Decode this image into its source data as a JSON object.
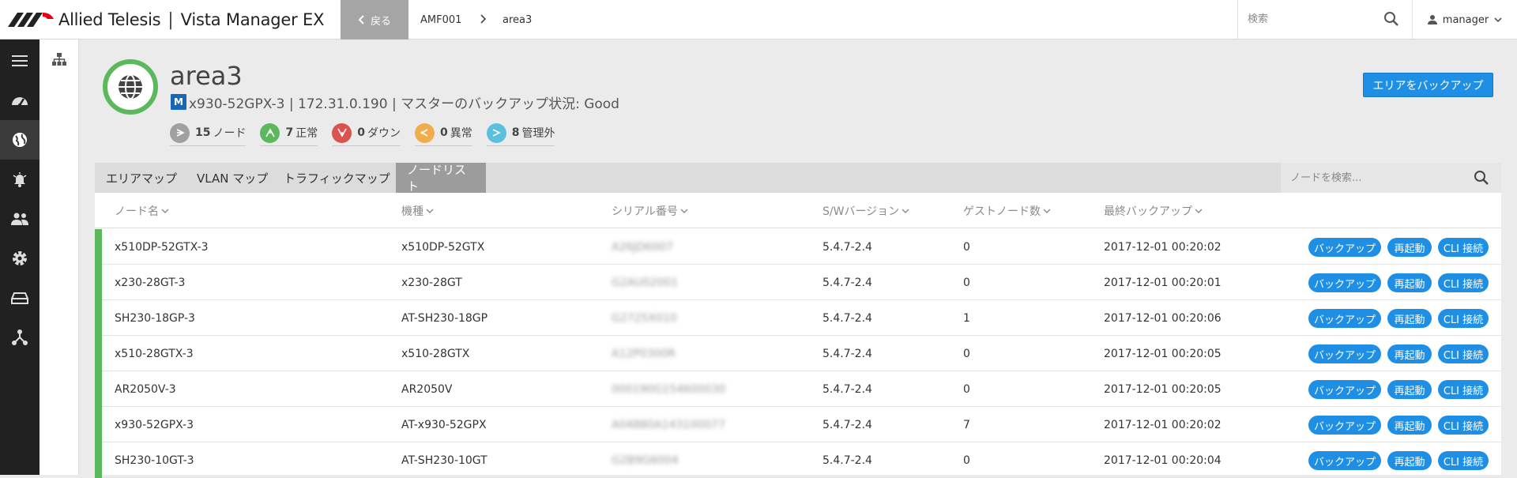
{
  "header": {
    "brand": "Allied Telesis",
    "separator": "|",
    "product": "Vista Manager EX",
    "back_label": "戻る",
    "breadcrumb": [
      "AMF001",
      "area3"
    ],
    "search_placeholder": "検索",
    "user": "manager",
    "logo_color": "#e60012"
  },
  "sidebar": {
    "items": [
      "menu-icon",
      "dashboard-icon",
      "globe-icon",
      "alarm-icon",
      "users-icon",
      "gear-icon",
      "storage-icon",
      "network-icon"
    ],
    "active": "globe-icon",
    "sub_items": [
      "topology-icon"
    ]
  },
  "area": {
    "title": "area3",
    "master_badge": "M",
    "subtitle": "x930-52GPX-3 | 172.31.0.190 | マスターのバックアップ状況: Good",
    "backup_button": "エリアをバックアップ",
    "stats": [
      {
        "count": "15",
        "label": "ノード",
        "color": "#a0a0a0",
        "icon": "node-icon"
      },
      {
        "count": "7",
        "label": "正常",
        "color": "#5cb85c",
        "icon": "ok-icon"
      },
      {
        "count": "0",
        "label": "ダウン",
        "color": "#d9534f",
        "icon": "down-icon"
      },
      {
        "count": "0",
        "label": "異常",
        "color": "#f0ad4e",
        "icon": "abnormal-icon"
      },
      {
        "count": "8",
        "label": "管理外",
        "color": "#5bc0de",
        "icon": "unmanaged-icon"
      }
    ]
  },
  "tabs": [
    {
      "label": "エリアマップ"
    },
    {
      "label": "VLAN マップ"
    },
    {
      "label": "トラフィックマップ"
    },
    {
      "label": "ノードリスト"
    }
  ],
  "active_tab": "ノードリスト",
  "node_search_placeholder": "ノードを検索...",
  "table": {
    "columns": [
      "ノード名",
      "機種",
      "シリアル番号",
      "S/Wバージョン",
      "ゲストノード数",
      "最終バックアップ"
    ],
    "actions": [
      "バックアップ",
      "再起動",
      "CLI 接続"
    ],
    "rows": [
      {
        "name": "x510DP-52GTX-3",
        "model": "x510DP-52GTX",
        "serial": "A26JD6007",
        "version": "5.4.7-2.4",
        "guests": "0",
        "backup": "2017-12-01 00:20:02"
      },
      {
        "name": "x230-28GT-3",
        "model": "x230-28GT",
        "serial": "G2AU02001",
        "version": "5.4.7-2.4",
        "guests": "0",
        "backup": "2017-12-01 00:20:01"
      },
      {
        "name": "SH230-18GP-3",
        "model": "AT-SH230-18GP",
        "serial": "G2725X010",
        "version": "5.4.7-2.4",
        "guests": "1",
        "backup": "2017-12-01 00:20:06"
      },
      {
        "name": "x510-28GTX-3",
        "model": "x510-28GTX",
        "serial": "A12P0300R",
        "version": "5.4.7-2.4",
        "guests": "0",
        "backup": "2017-12-01 00:20:05"
      },
      {
        "name": "AR2050V-3",
        "model": "AR2050V",
        "serial": "000190G154600030",
        "version": "5.4.7-2.4",
        "guests": "0",
        "backup": "2017-12-01 00:20:05"
      },
      {
        "name": "x930-52GPX-3",
        "model": "AT-x930-52GPX",
        "serial": "A04880A143100077",
        "version": "5.4.7-2.4",
        "guests": "7",
        "backup": "2017-12-01 00:20:02"
      },
      {
        "name": "SH230-10GT-3",
        "model": "AT-SH230-10GT",
        "serial": "G2B9G6004",
        "version": "5.4.7-2.4",
        "guests": "0",
        "backup": "2017-12-01 00:20:04"
      }
    ]
  }
}
